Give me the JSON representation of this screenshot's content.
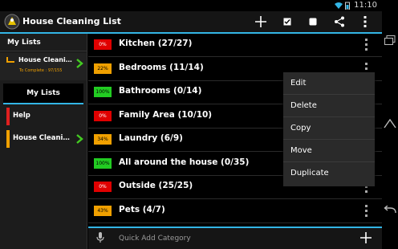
{
  "status": {
    "time": "11:10"
  },
  "app": {
    "title": "House Cleaning List"
  },
  "sidebar": {
    "header": "My Lists",
    "current_list": {
      "label": "House Cleanin...",
      "subtitle": "To Complete : 97/155"
    },
    "mylists_button": "My Lists",
    "items": [
      {
        "label": "Help",
        "color": "#e02020"
      },
      {
        "label": "House Cleaning L...",
        "color": "#f0a000"
      }
    ]
  },
  "categories": [
    {
      "percent": "0%",
      "name": "Kitchen (27/27)",
      "color": "#e00000",
      "text_color": "#ffffff"
    },
    {
      "percent": "22%",
      "name": "Bedrooms (11/14)",
      "color": "#f0a000",
      "text_color": "#000000"
    },
    {
      "percent": "100%",
      "name": "Bathrooms (0/14)",
      "color": "#22cc22",
      "text_color": "#000000"
    },
    {
      "percent": "0%",
      "name": "Family Area (10/10)",
      "color": "#e00000",
      "text_color": "#ffffff"
    },
    {
      "percent": "34%",
      "name": "Laundry (6/9)",
      "color": "#f0a000",
      "text_color": "#000000"
    },
    {
      "percent": "100%",
      "name": "All around the house (0/35)",
      "color": "#22cc22",
      "text_color": "#000000"
    },
    {
      "percent": "0%",
      "name": "Outside (25/25)",
      "color": "#e00000",
      "text_color": "#ffffff"
    },
    {
      "percent": "43%",
      "name": "Pets (4/7)",
      "color": "#f0a000",
      "text_color": "#000000"
    }
  ],
  "context_menu": [
    "Edit",
    "Delete",
    "Copy",
    "Move",
    "Duplicate"
  ],
  "bottom": {
    "placeholder": "Quick Add Category"
  },
  "colors": {
    "accent": "#33b5e5"
  },
  "icons": {
    "toolbar": [
      "add-icon",
      "check-all-icon",
      "uncheck-all-icon",
      "share-icon",
      "overflow-menu-icon"
    ],
    "nav": [
      "back-icon",
      "home-icon",
      "recents-icon"
    ]
  }
}
